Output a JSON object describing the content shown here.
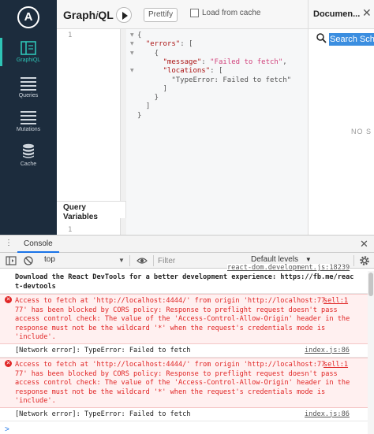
{
  "sidebar": {
    "logo": "A",
    "items": [
      {
        "label": "GraphiQL",
        "icon": "graphiql-icon",
        "active": true
      },
      {
        "label": "Queries",
        "icon": "list-icon"
      },
      {
        "label": "Mutations",
        "icon": "list-icon"
      },
      {
        "label": "Cache",
        "icon": "database-icon"
      }
    ]
  },
  "toolbar": {
    "title_main": "Graph",
    "title_italic": "i",
    "title_rest": "QL",
    "prettify_label": "Prettify",
    "load_cache_label": "Load from cache",
    "load_cache_checked": false
  },
  "query": {
    "line_number": "1",
    "variables_title": "Query Variables",
    "variables_line_number": "1"
  },
  "result": {
    "lines": [
      "{",
      "  \"errors\": [",
      "    {",
      "      \"message\": \"Failed to fetch\",",
      "      \"locations\": [",
      "        \"TypeError: Failed to fetch\"",
      "      ]",
      "    }",
      "  ]",
      "}"
    ]
  },
  "docs": {
    "title": "Documen...",
    "search_text": "Search Sche",
    "empty_text": "NO S"
  },
  "devtools": {
    "tab": "Console",
    "context": "top",
    "filter_placeholder": "Filter",
    "levels": "Default levels",
    "prompt": ">",
    "logs": [
      {
        "type": "info",
        "source": "react-dom.development.js:18239",
        "lines": [
          "Download the React DevTools for a better development experience: https://fb.me/reac",
          "t-devtools"
        ]
      },
      {
        "type": "error",
        "source": "sell:1",
        "lines": [
          "Access to fetch at 'http://localhost:4444/' from origin 'http://localhost:77",
          "77' has been blocked by CORS policy: Response to preflight request doesn't pass",
          "access control check: The value of the 'Access-Control-Allow-Origin' header in the",
          "response must not be the wildcard '*' when the request's credentials mode is",
          "'include'."
        ]
      },
      {
        "type": "log",
        "source": "index.js:86",
        "lines": [
          "[Network error]: TypeError: Failed to fetch"
        ]
      },
      {
        "type": "error",
        "source": "sell:1",
        "lines": [
          "Access to fetch at 'http://localhost:4444/' from origin 'http://localhost:77",
          "77' has been blocked by CORS policy: Response to preflight request doesn't pass",
          "access control check: The value of the 'Access-Control-Allow-Origin' header in the",
          "response must not be the wildcard '*' when the request's credentials mode is",
          "'include'."
        ]
      },
      {
        "type": "log",
        "source": "index.js:86",
        "lines": [
          "[Network error]: TypeError: Failed to fetch"
        ]
      }
    ]
  },
  "colors": {
    "sidebar_bg": "#1c2c3d",
    "accent": "#2ec4b6",
    "error_red": "#e02424",
    "error_bg": "#fff0f0",
    "json_key": "#a11",
    "json_string": "#d1417b"
  }
}
